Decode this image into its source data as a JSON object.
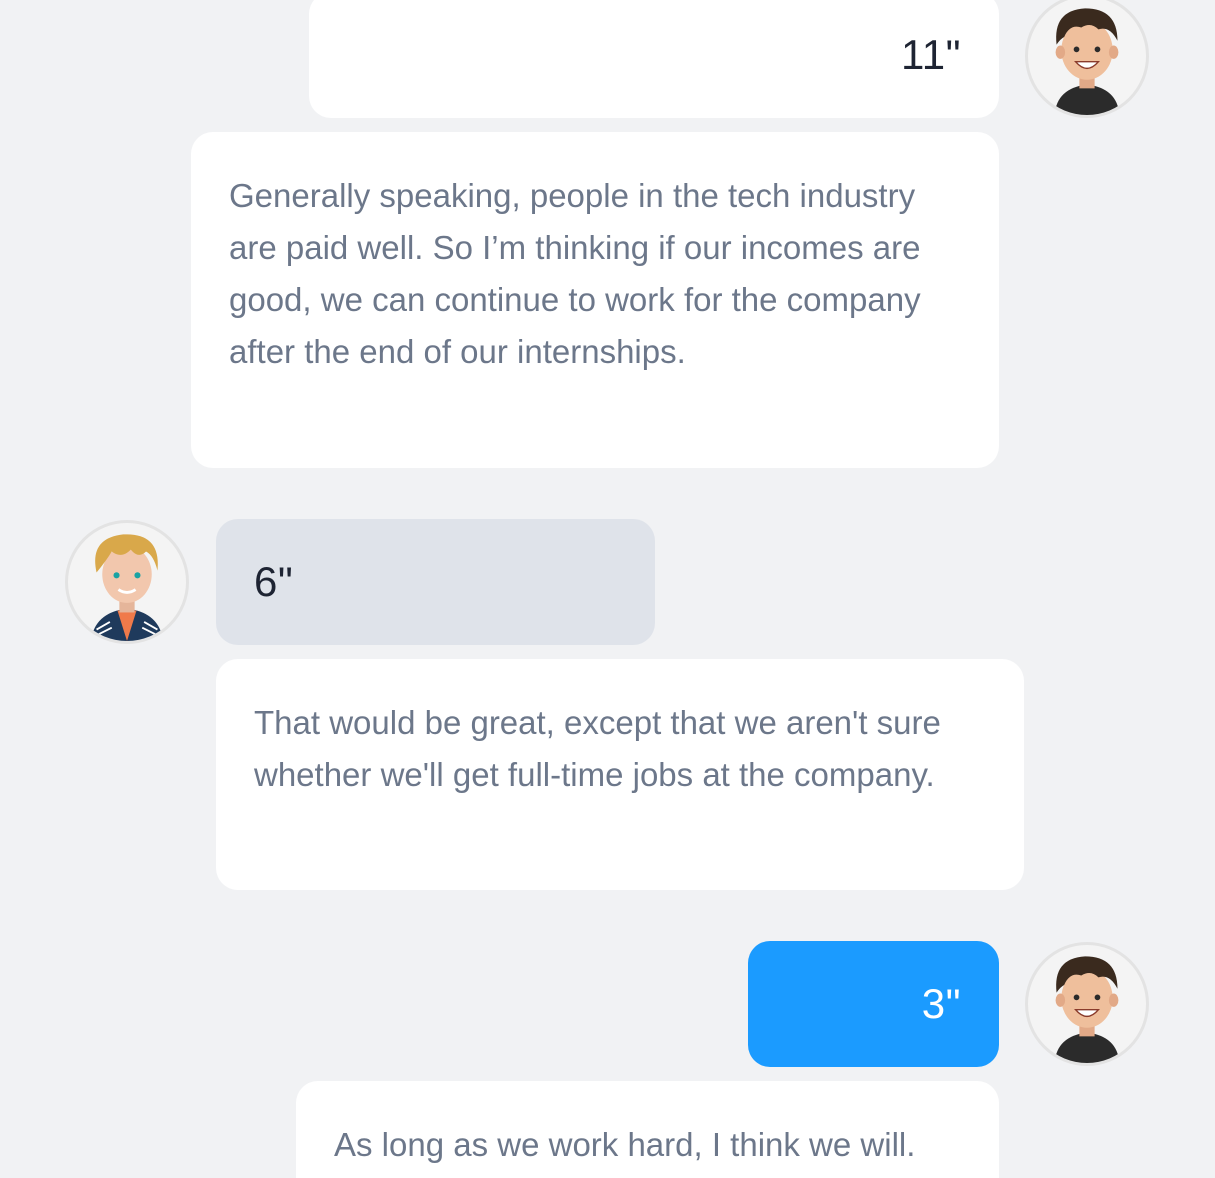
{
  "conversation": {
    "messages": [
      {
        "speaker": "self",
        "duration": "11\"",
        "text": "Generally speaking, people in the tech industry are paid well. So I’m thinking if our incomes are good, we can continue to work for the company after the end of our internships."
      },
      {
        "speaker": "other",
        "duration": "6\"",
        "text": "That would be great, except that we aren't sure whether we'll get full-time jobs at the company."
      },
      {
        "speaker": "self",
        "duration": "3\"",
        "text": "As long as we work hard, I think we will."
      }
    ]
  },
  "avatars": {
    "self": "dark-haired-boy-avatar",
    "other": "blond-boy-avatar"
  },
  "colors": {
    "background": "#f1f2f4",
    "bubble_white": "#ffffff",
    "bubble_grey": "#dfe3ea",
    "bubble_active": "#1b9bff",
    "text_secondary": "#6c778a",
    "text_primary": "#1e2433"
  }
}
